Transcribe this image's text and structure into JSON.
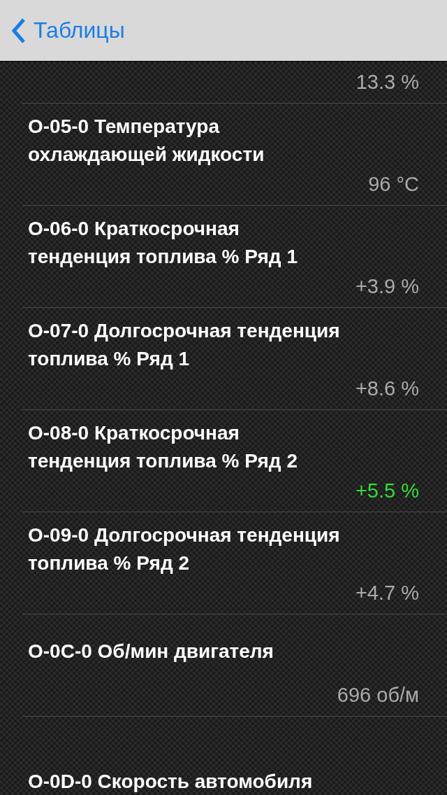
{
  "nav_bar": {
    "back_label": "Таблицы"
  },
  "rows": [
    {
      "value": "13.3 %",
      "color": "#aaaaaa"
    },
    {
      "title": "O-05-0 Температура\nохлаждающей жидкости",
      "value": "96 °C",
      "color": "#aaaaaa"
    },
    {
      "title": "O-06-0 Краткосрочная\nтенденция топлива % Ряд 1",
      "value": "+3.9 %",
      "color": "#aaaaaa"
    },
    {
      "title": "O-07-0 Долгосрочная тенденция\nтоплива % Ряд 1",
      "value": "+8.6 %",
      "color": "#aaaaaa"
    },
    {
      "title": "O-08-0 Краткосрочная\nтенденция топлива % Ряд 2",
      "value": "+5.5 %",
      "color": "#33dd33"
    },
    {
      "title": "O-09-0 Долгосрочная тенденция\nтоплива % Ряд 2",
      "value": "+4.7 %",
      "color": "#aaaaaa"
    },
    {
      "title": "O-0C-0 Об/мин двигателя",
      "value": "696 об/м",
      "color": "#aaaaaa"
    },
    {
      "title": "O-0D-0 Скорость автомобиля"
    }
  ]
}
